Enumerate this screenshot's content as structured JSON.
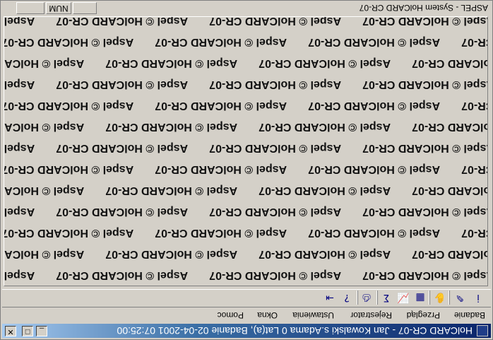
{
  "window": {
    "title": "HolCARD CR-07 - Jan Kowalski s.Adama 0 Lat(a), Badanie 02-04-2001 07:25:00",
    "minimize_label": "_",
    "maximize_label": "□",
    "close_label": "✕"
  },
  "menu": [
    "Badanie",
    "Przegląd",
    "Rejestrator",
    "Ustawienia",
    "Okna",
    "Pomoc"
  ],
  "toolbar": {
    "icons": [
      "info-icon",
      "edit-icon",
      "hand-icon",
      "table-icon",
      "chart-icon",
      "sigma-icon",
      "printer-icon",
      "help-icon",
      "exit-icon"
    ],
    "glyphs": [
      "i",
      "✎",
      "✋",
      "▦",
      "📈",
      "Σ",
      "⎙",
      "?",
      "⇥"
    ]
  },
  "watermark": {
    "text": "Aspel © HolCARD CR-07"
  },
  "statusbar": {
    "text": "ASPEL - System HolCARD CR-07",
    "num_indicator": "NUM"
  }
}
